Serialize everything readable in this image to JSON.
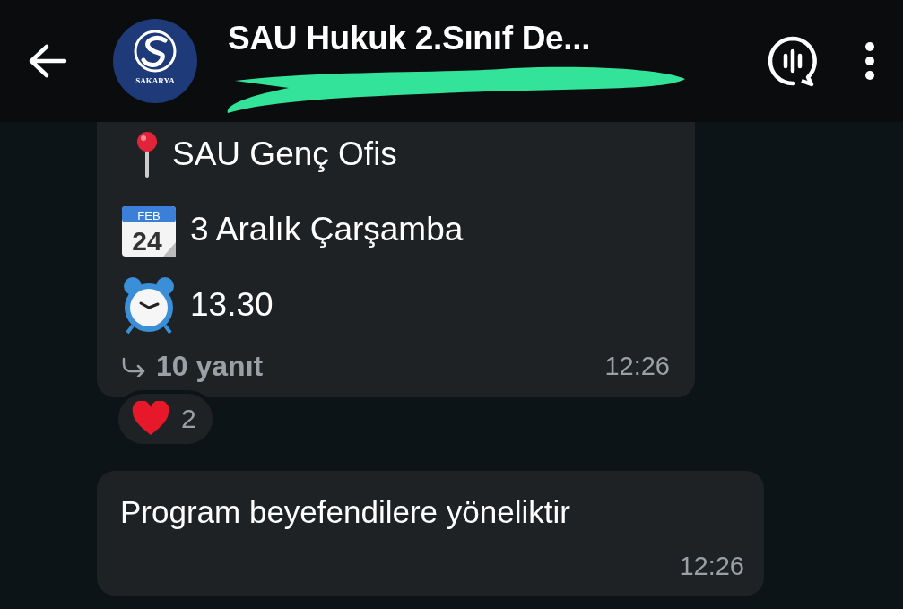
{
  "header": {
    "title": "SAU Hukuk 2.Sınıf De...",
    "logo_text": "SAKARYA",
    "redacted": true
  },
  "messages": [
    {
      "lines": [
        {
          "kind": "pin",
          "text": "SAU Genç Ofis"
        },
        {
          "kind": "calendar",
          "text": "3 Aralık Çarşamba",
          "month": "FEB",
          "day": "24"
        },
        {
          "kind": "clock",
          "text": "13.30"
        }
      ],
      "replies": "10 yanıt",
      "time": "12:26",
      "reaction": {
        "kind": "heart",
        "count": "2"
      }
    },
    {
      "lines": [
        {
          "kind": "plain",
          "text": "Program beyefendilere yöneliktir"
        }
      ],
      "time": "12:26"
    }
  ]
}
